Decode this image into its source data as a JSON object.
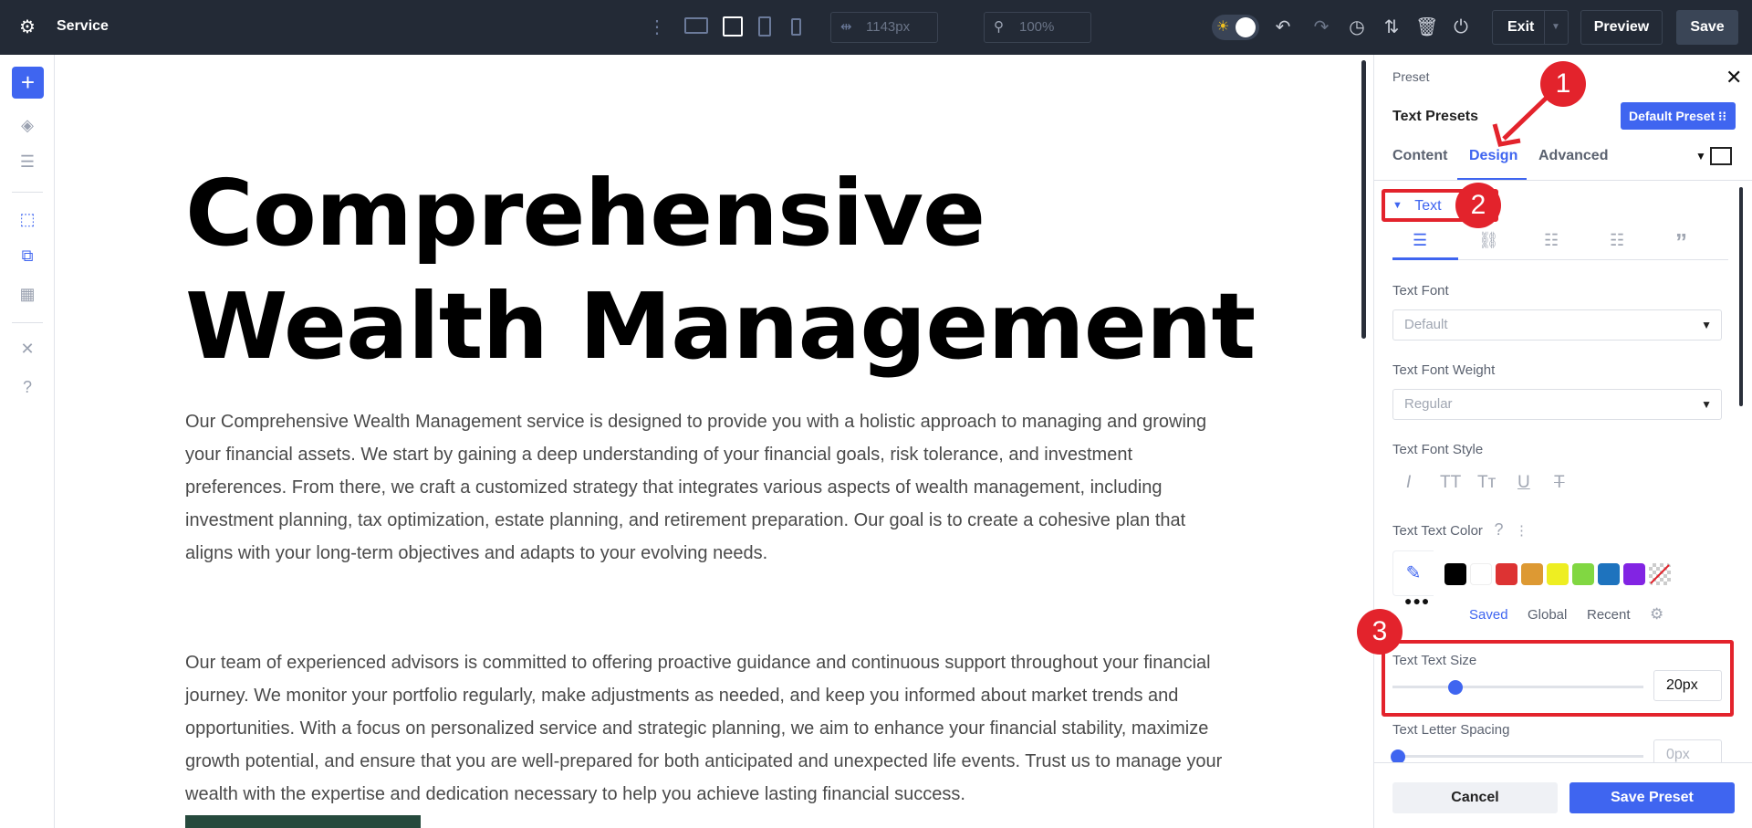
{
  "topbar": {
    "title": "Service",
    "width_value": "1143px",
    "zoom_value": "100%",
    "exit_label": "Exit",
    "preview_label": "Preview",
    "save_label": "Save"
  },
  "canvas": {
    "heading_line1": "Comprehensive",
    "heading_line2": "Wealth Management",
    "paragraphs": [
      "Our Comprehensive Wealth Management service is designed to provide you with a holistic approach to managing and growing your financial assets. We start by gaining a deep understanding of your financial goals, risk tolerance, and investment preferences. From there, we craft a customized strategy that integrates various aspects of wealth management, including investment planning, tax optimization, estate planning, and retirement preparation. Our goal is to create a cohesive plan that aligns with your long-term objectives and adapts to your evolving needs.",
      "Our team of experienced advisors is committed to offering proactive guidance and continuous support throughout your financial journey. We monitor your portfolio regularly, make adjustments as needed, and keep you informed about market trends and opportunities. With a focus on personalized service and strategic planning, we aim to enhance your financial stability, maximize growth potential, and ensure that you are well-prepared for both anticipated and unexpected life events. Trust us to manage your wealth with the expertise and dedication necessary to help you achieve lasting financial success."
    ],
    "button_color": "#264a3d"
  },
  "panel": {
    "preset_label": "Preset",
    "title": "Text Presets",
    "default_preset": "Default Preset",
    "tabs": [
      {
        "label": "Content"
      },
      {
        "label": "Design",
        "active": true
      },
      {
        "label": "Advanced"
      }
    ],
    "section": "Text",
    "text_font_label": "Text Font",
    "text_font_value": "Default",
    "font_weight_label": "Text Font Weight",
    "font_weight_value": "Regular",
    "font_style_label": "Text Font Style",
    "font_style_icons": [
      "I",
      "TT",
      "Tт",
      "U",
      "T"
    ],
    "text_color_label": "Text Text Color",
    "help": "?",
    "swatches": [
      "#000000",
      "#ffffff",
      "#dd3333",
      "#dd9933",
      "#eeee22",
      "#81d742",
      "#1e73be",
      "#8224e3"
    ],
    "color_tabs": [
      "Saved",
      "Global",
      "Recent"
    ],
    "text_size_label": "Text Text Size",
    "text_size_value": "20px",
    "text_size_percent": 0.25,
    "letter_spacing_label": "Text Letter Spacing",
    "letter_spacing_value": "0px",
    "cancel_label": "Cancel",
    "save_preset_label": "Save Preset"
  },
  "annotations": [
    "1",
    "2",
    "3"
  ],
  "accent": "#3f65f0",
  "annotation_color": "#e3232c"
}
